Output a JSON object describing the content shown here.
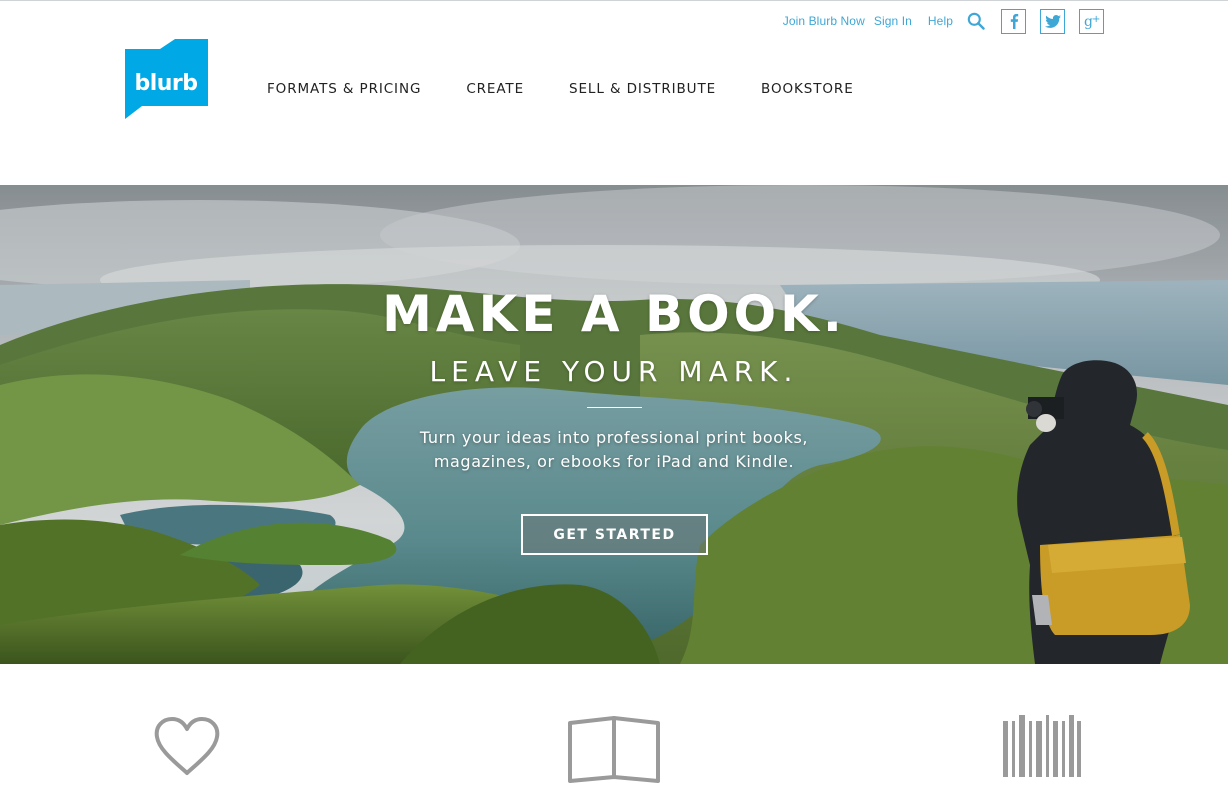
{
  "header": {
    "utility_links": {
      "join": "Join Blurb Now",
      "signin": "Sign In",
      "help": "Help"
    },
    "social": [
      "facebook-icon",
      "twitter-icon",
      "google-plus-icon"
    ],
    "logo_text": "blurb",
    "nav": [
      "FORMATS & PRICING",
      "CREATE",
      "SELL & DISTRIBUTE",
      "BOOKSTORE"
    ]
  },
  "hero": {
    "headline": "MAKE A BOOK.",
    "subheadline": "LEAVE YOUR MARK.",
    "description_line1": "Turn your ideas into professional print books,",
    "description_line2": "magazines, or ebooks for iPad and Kindle.",
    "cta_label": "GET STARTED"
  },
  "features": {
    "icons": [
      "heart-icon",
      "open-book-icon",
      "barcode-icon"
    ]
  },
  "colors": {
    "brand": "#00a8e6",
    "link": "#3ea7d6",
    "nav_text": "#222222",
    "feature_icon": "#9a9a9a"
  }
}
